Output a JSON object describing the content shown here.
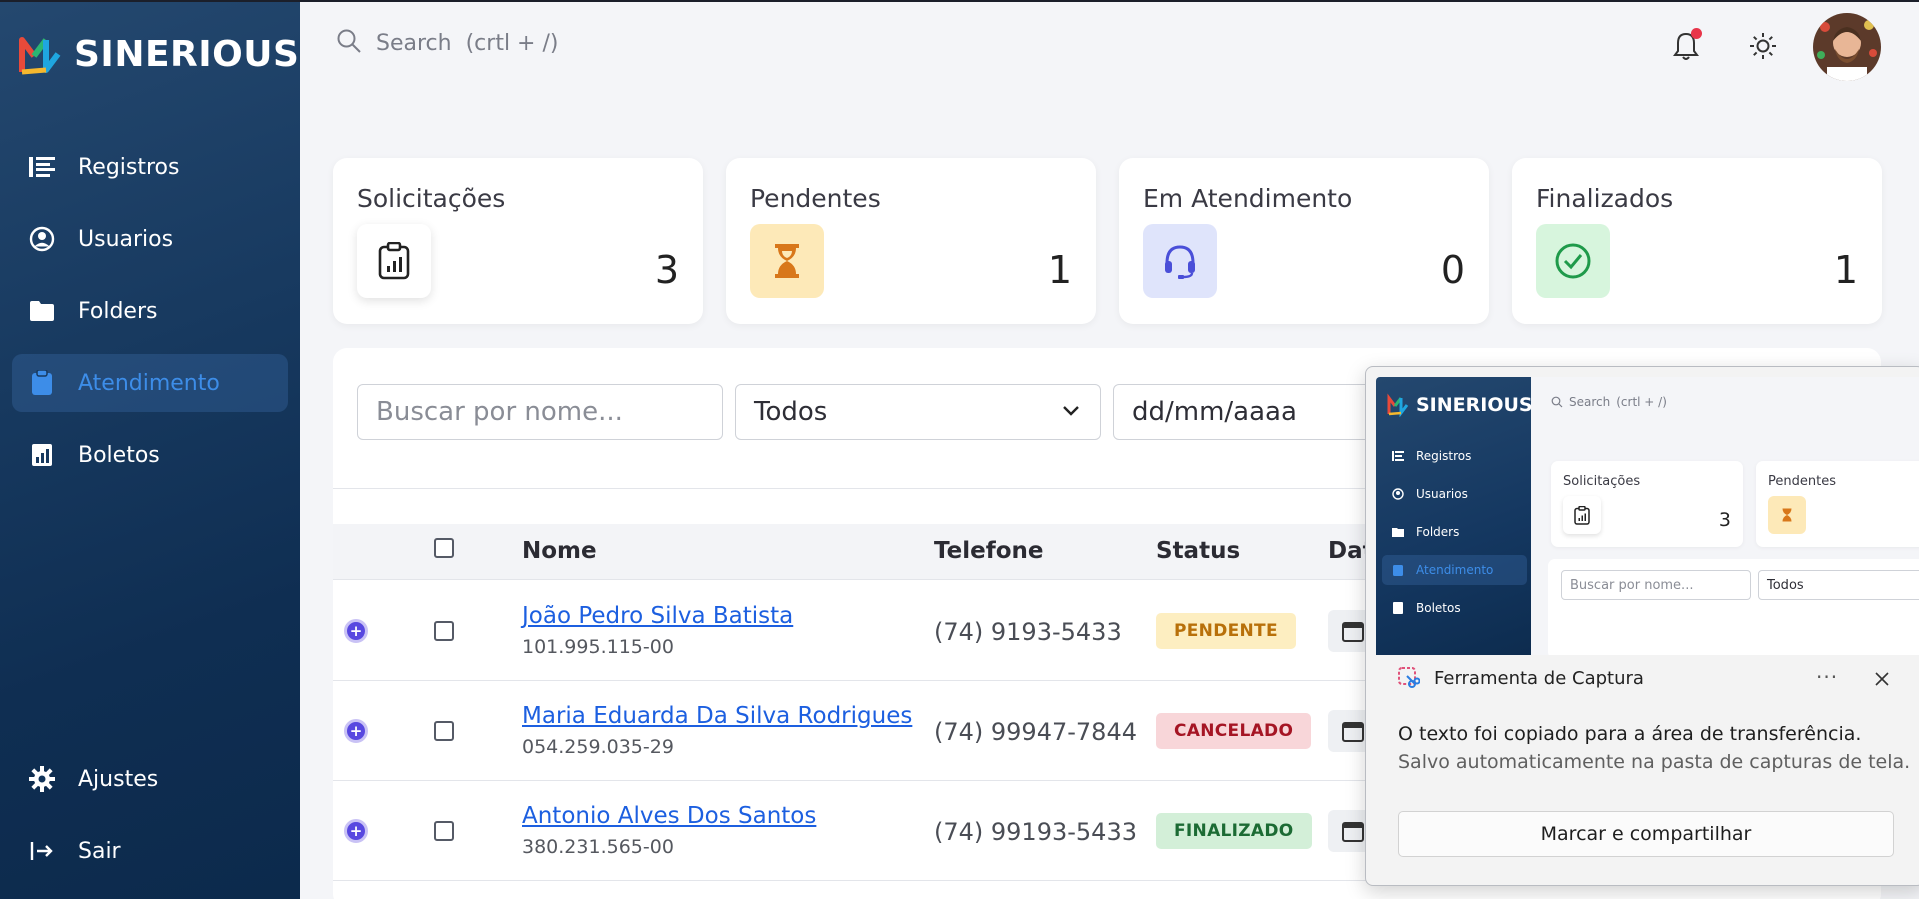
{
  "brand": {
    "name": "SINERIOUS"
  },
  "header": {
    "search_placeholder": "Search",
    "search_shortcut": "(crtl + /)"
  },
  "sidebar": {
    "items": [
      {
        "label": "Registros",
        "icon": "list-icon"
      },
      {
        "label": "Usuarios",
        "icon": "user-circle-icon"
      },
      {
        "label": "Folders",
        "icon": "folder-icon"
      },
      {
        "label": "Atendimento",
        "icon": "clipboard-icon",
        "active": true
      },
      {
        "label": "Boletos",
        "icon": "chart-report-icon"
      }
    ],
    "bottom": [
      {
        "label": "Ajustes",
        "icon": "gear-icon"
      },
      {
        "label": "Sair",
        "icon": "logout-icon"
      }
    ]
  },
  "stats": [
    {
      "title": "Solicitações",
      "value": "3",
      "icon": "clipboard-chart-icon"
    },
    {
      "title": "Pendentes",
      "value": "1",
      "icon": "hourglass-icon"
    },
    {
      "title": "Em Atendimento",
      "value": "0",
      "icon": "headset-icon"
    },
    {
      "title": "Finalizados",
      "value": "1",
      "icon": "check-circle-icon"
    }
  ],
  "filters": {
    "name_placeholder": "Buscar por nome...",
    "status_value": "Todos",
    "date_placeholder": "dd/mm/aaaa"
  },
  "table": {
    "headers": {
      "nome": "Nome",
      "telefone": "Telefone",
      "status": "Status",
      "data": "Dat"
    },
    "rows": [
      {
        "nome": "João Pedro Silva Batista",
        "cpf": "101.995.115-00",
        "telefone": "(74) 9193-5433",
        "status": "PENDENTE"
      },
      {
        "nome": "Maria Eduarda Da Silva Rodrigues",
        "cpf": "054.259.035-29",
        "telefone": "(74) 99947-7844",
        "status": "CANCELADO"
      },
      {
        "nome": "Antonio Alves Dos Santos",
        "cpf": "380.231.565-00",
        "telefone": "(74) 99193-5433",
        "status": "FINALIZADO"
      }
    ]
  },
  "snip": {
    "app_title": "Ferramenta de Captura",
    "more": "···",
    "message": "O texto foi copiado para a área de transferência.",
    "submessage": "Salvo automaticamente na pasta de capturas de tela.",
    "button": "Marcar e compartilhar",
    "thumb": {
      "brand": "SINERIOUS",
      "search": "Search",
      "shortcut": "(crtl + /)",
      "nav": [
        "Registros",
        "Usuarios",
        "Folders",
        "Atendimento",
        "Boletos"
      ],
      "cards": [
        {
          "title": "Solicitações",
          "value": "3"
        },
        {
          "title": "Pendentes",
          "value": ""
        }
      ],
      "name_placeholder": "Buscar por nome...",
      "status_value": "Todos"
    }
  },
  "colors": {
    "accent": "#3d8de8",
    "link": "#1c5fe0",
    "sidebar": "#17395f",
    "notification": "#e8354a"
  }
}
